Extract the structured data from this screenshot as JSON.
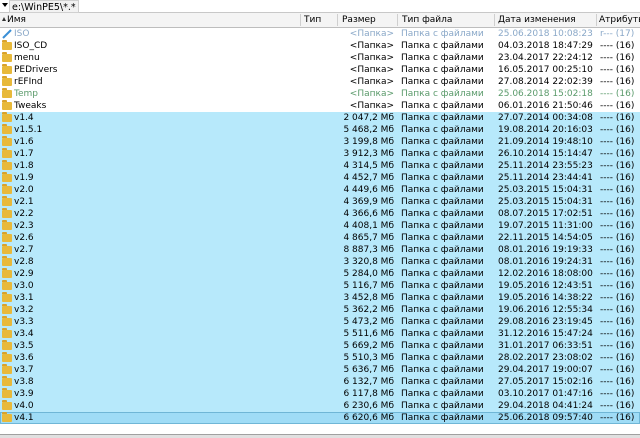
{
  "path": "e:\\WinPE5\\*.*",
  "columns": {
    "name": "Имя",
    "ext": "Тип",
    "size": "Размер",
    "type": "Тип файла",
    "date": "Дата изменения",
    "attr": "Атрибуты"
  },
  "rows": [
    {
      "name": "ISO",
      "size": "<Папка>",
      "type": "Папка с файлами",
      "date": "25.06.2018 10:08:23",
      "attr": "r--- (17)",
      "kind": "link"
    },
    {
      "name": "ISO_CD",
      "size": "<Папка>",
      "type": "Папка с файлами",
      "date": "04.03.2018 18:47:29",
      "attr": "---- (16)",
      "kind": "dir"
    },
    {
      "name": "menu",
      "size": "<Папка>",
      "type": "Папка с файлами",
      "date": "23.04.2017 22:24:12",
      "attr": "---- (16)",
      "kind": "dir"
    },
    {
      "name": "PEDrivers",
      "size": "<Папка>",
      "type": "Папка с файлами",
      "date": "16.05.2017 00:25:10",
      "attr": "---- (16)",
      "kind": "dir"
    },
    {
      "name": "rEFInd",
      "size": "<Папка>",
      "type": "Папка с файлами",
      "date": "27.08.2014 22:02:39",
      "attr": "---- (16)",
      "kind": "dir"
    },
    {
      "name": "Temp",
      "size": "<Папка>",
      "type": "Папка с файлами",
      "date": "25.06.2018 15:02:18",
      "attr": "---- (16)",
      "kind": "green"
    },
    {
      "name": "Tweaks",
      "size": "<Папка>",
      "type": "Папка с файлами",
      "date": "06.01.2016 21:50:46",
      "attr": "---- (16)",
      "kind": "dir"
    },
    {
      "name": "v1.4",
      "size": "2 047,2 Мб",
      "type": "Папка с файлами",
      "date": "27.07.2014 00:34:08",
      "attr": "---- (16)",
      "kind": "ver"
    },
    {
      "name": "v1.5.1",
      "size": "5 468,2 Мб",
      "type": "Папка с файлами",
      "date": "19.08.2014 20:16:03",
      "attr": "---- (16)",
      "kind": "ver"
    },
    {
      "name": "v1.6",
      "size": "3 199,8 Мб",
      "type": "Папка с файлами",
      "date": "21.09.2014 19:48:10",
      "attr": "---- (16)",
      "kind": "ver"
    },
    {
      "name": "v1.7",
      "size": "3 912,3 Мб",
      "type": "Папка с файлами",
      "date": "26.10.2014 15:14:47",
      "attr": "---- (16)",
      "kind": "ver"
    },
    {
      "name": "v1.8",
      "size": "4 314,5 Мб",
      "type": "Папка с файлами",
      "date": "25.11.2014 23:55:23",
      "attr": "---- (16)",
      "kind": "ver"
    },
    {
      "name": "v1.9",
      "size": "4 452,7 Мб",
      "type": "Папка с файлами",
      "date": "25.11.2014 23:44:41",
      "attr": "---- (16)",
      "kind": "ver"
    },
    {
      "name": "v2.0",
      "size": "4 449,6 Мб",
      "type": "Папка с файлами",
      "date": "25.03.2015 15:04:31",
      "attr": "---- (16)",
      "kind": "ver"
    },
    {
      "name": "v2.1",
      "size": "4 369,9 Мб",
      "type": "Папка с файлами",
      "date": "25.03.2015 15:04:31",
      "attr": "---- (16)",
      "kind": "ver"
    },
    {
      "name": "v2.2",
      "size": "4 366,6 Мб",
      "type": "Папка с файлами",
      "date": "08.07.2015 17:02:51",
      "attr": "---- (16)",
      "kind": "ver"
    },
    {
      "name": "v2.3",
      "size": "4 408,1 Мб",
      "type": "Папка с файлами",
      "date": "19.07.2015 11:31:00",
      "attr": "---- (16)",
      "kind": "ver"
    },
    {
      "name": "v2.6",
      "size": "4 865,7 Мб",
      "type": "Папка с файлами",
      "date": "22.11.2015 14:54:05",
      "attr": "---- (16)",
      "kind": "ver"
    },
    {
      "name": "v2.7",
      "size": "8 887,3 Мб",
      "type": "Папка с файлами",
      "date": "08.01.2016 19:19:33",
      "attr": "---- (16)",
      "kind": "ver"
    },
    {
      "name": "v2.8",
      "size": "3 320,8 Мб",
      "type": "Папка с файлами",
      "date": "08.01.2016 19:24:31",
      "attr": "---- (16)",
      "kind": "ver"
    },
    {
      "name": "v2.9",
      "size": "5 284,0 Мб",
      "type": "Папка с файлами",
      "date": "12.02.2016 18:08:00",
      "attr": "---- (16)",
      "kind": "ver"
    },
    {
      "name": "v3.0",
      "size": "5 116,7 Мб",
      "type": "Папка с файлами",
      "date": "19.05.2016 12:43:51",
      "attr": "---- (16)",
      "kind": "ver"
    },
    {
      "name": "v3.1",
      "size": "3 452,8 Мб",
      "type": "Папка с файлами",
      "date": "19.05.2016 14:38:22",
      "attr": "---- (16)",
      "kind": "ver"
    },
    {
      "name": "v3.2",
      "size": "5 362,2 Мб",
      "type": "Папка с файлами",
      "date": "19.06.2016 12:55:34",
      "attr": "---- (16)",
      "kind": "ver"
    },
    {
      "name": "v3.3",
      "size": "5 473,2 Мб",
      "type": "Папка с файлами",
      "date": "29.08.2016 23:19:45",
      "attr": "---- (16)",
      "kind": "ver"
    },
    {
      "name": "v3.4",
      "size": "5 511,6 Мб",
      "type": "Папка с файлами",
      "date": "31.12.2016 15:47:24",
      "attr": "---- (16)",
      "kind": "ver"
    },
    {
      "name": "v3.5",
      "size": "5 669,2 Мб",
      "type": "Папка с файлами",
      "date": "31.01.2017 06:33:51",
      "attr": "---- (16)",
      "kind": "ver"
    },
    {
      "name": "v3.6",
      "size": "5 510,3 Мб",
      "type": "Папка с файлами",
      "date": "28.02.2017 23:08:02",
      "attr": "---- (16)",
      "kind": "ver"
    },
    {
      "name": "v3.7",
      "size": "5 636,7 Мб",
      "type": "Папка с файлами",
      "date": "29.04.2017 19:00:07",
      "attr": "---- (16)",
      "kind": "ver"
    },
    {
      "name": "v3.8",
      "size": "6 132,7 Мб",
      "type": "Папка с файлами",
      "date": "27.05.2017 15:02:16",
      "attr": "---- (16)",
      "kind": "ver"
    },
    {
      "name": "v3.9",
      "size": "6 117,8 Мб",
      "type": "Папка с файлами",
      "date": "03.10.2017 01:47:16",
      "attr": "---- (16)",
      "kind": "ver"
    },
    {
      "name": "v4.0",
      "size": "6 230,6 Мб",
      "type": "Папка с файлами",
      "date": "29.04.2018 04:41:24",
      "attr": "---- (16)",
      "kind": "ver"
    },
    {
      "name": "v4.1",
      "size": "6 620,6 Мб",
      "type": "Папка с файлами",
      "date": "25.06.2018 09:57:40",
      "attr": "---- (16)",
      "kind": "sel"
    }
  ]
}
